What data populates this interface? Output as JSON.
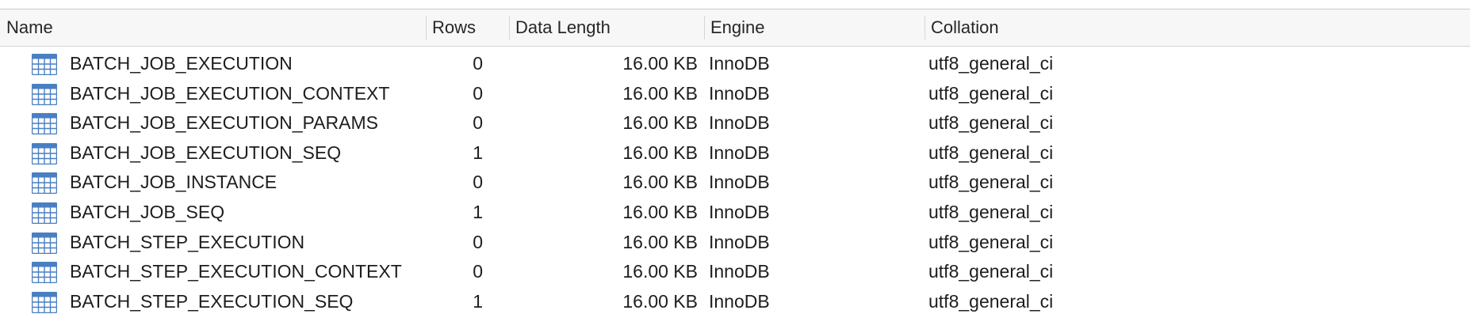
{
  "header": {
    "name": "Name",
    "rows": "Rows",
    "data_length": "Data Length",
    "engine": "Engine",
    "collation": "Collation"
  },
  "table_icon": "table-grid-icon",
  "colors": {
    "icon_blue": "#4a7fc1",
    "header_bg": "#f7f7f7"
  },
  "tables": [
    {
      "name": "BATCH_JOB_EXECUTION",
      "rows": "0",
      "data_length": "16.00 KB",
      "engine": "InnoDB",
      "collation": "utf8_general_ci"
    },
    {
      "name": "BATCH_JOB_EXECUTION_CONTEXT",
      "rows": "0",
      "data_length": "16.00 KB",
      "engine": "InnoDB",
      "collation": "utf8_general_ci"
    },
    {
      "name": "BATCH_JOB_EXECUTION_PARAMS",
      "rows": "0",
      "data_length": "16.00 KB",
      "engine": "InnoDB",
      "collation": "utf8_general_ci"
    },
    {
      "name": "BATCH_JOB_EXECUTION_SEQ",
      "rows": "1",
      "data_length": "16.00 KB",
      "engine": "InnoDB",
      "collation": "utf8_general_ci"
    },
    {
      "name": "BATCH_JOB_INSTANCE",
      "rows": "0",
      "data_length": "16.00 KB",
      "engine": "InnoDB",
      "collation": "utf8_general_ci"
    },
    {
      "name": "BATCH_JOB_SEQ",
      "rows": "1",
      "data_length": "16.00 KB",
      "engine": "InnoDB",
      "collation": "utf8_general_ci"
    },
    {
      "name": "BATCH_STEP_EXECUTION",
      "rows": "0",
      "data_length": "16.00 KB",
      "engine": "InnoDB",
      "collation": "utf8_general_ci"
    },
    {
      "name": "BATCH_STEP_EXECUTION_CONTEXT",
      "rows": "0",
      "data_length": "16.00 KB",
      "engine": "InnoDB",
      "collation": "utf8_general_ci"
    },
    {
      "name": "BATCH_STEP_EXECUTION_SEQ",
      "rows": "1",
      "data_length": "16.00 KB",
      "engine": "InnoDB",
      "collation": "utf8_general_ci"
    }
  ]
}
